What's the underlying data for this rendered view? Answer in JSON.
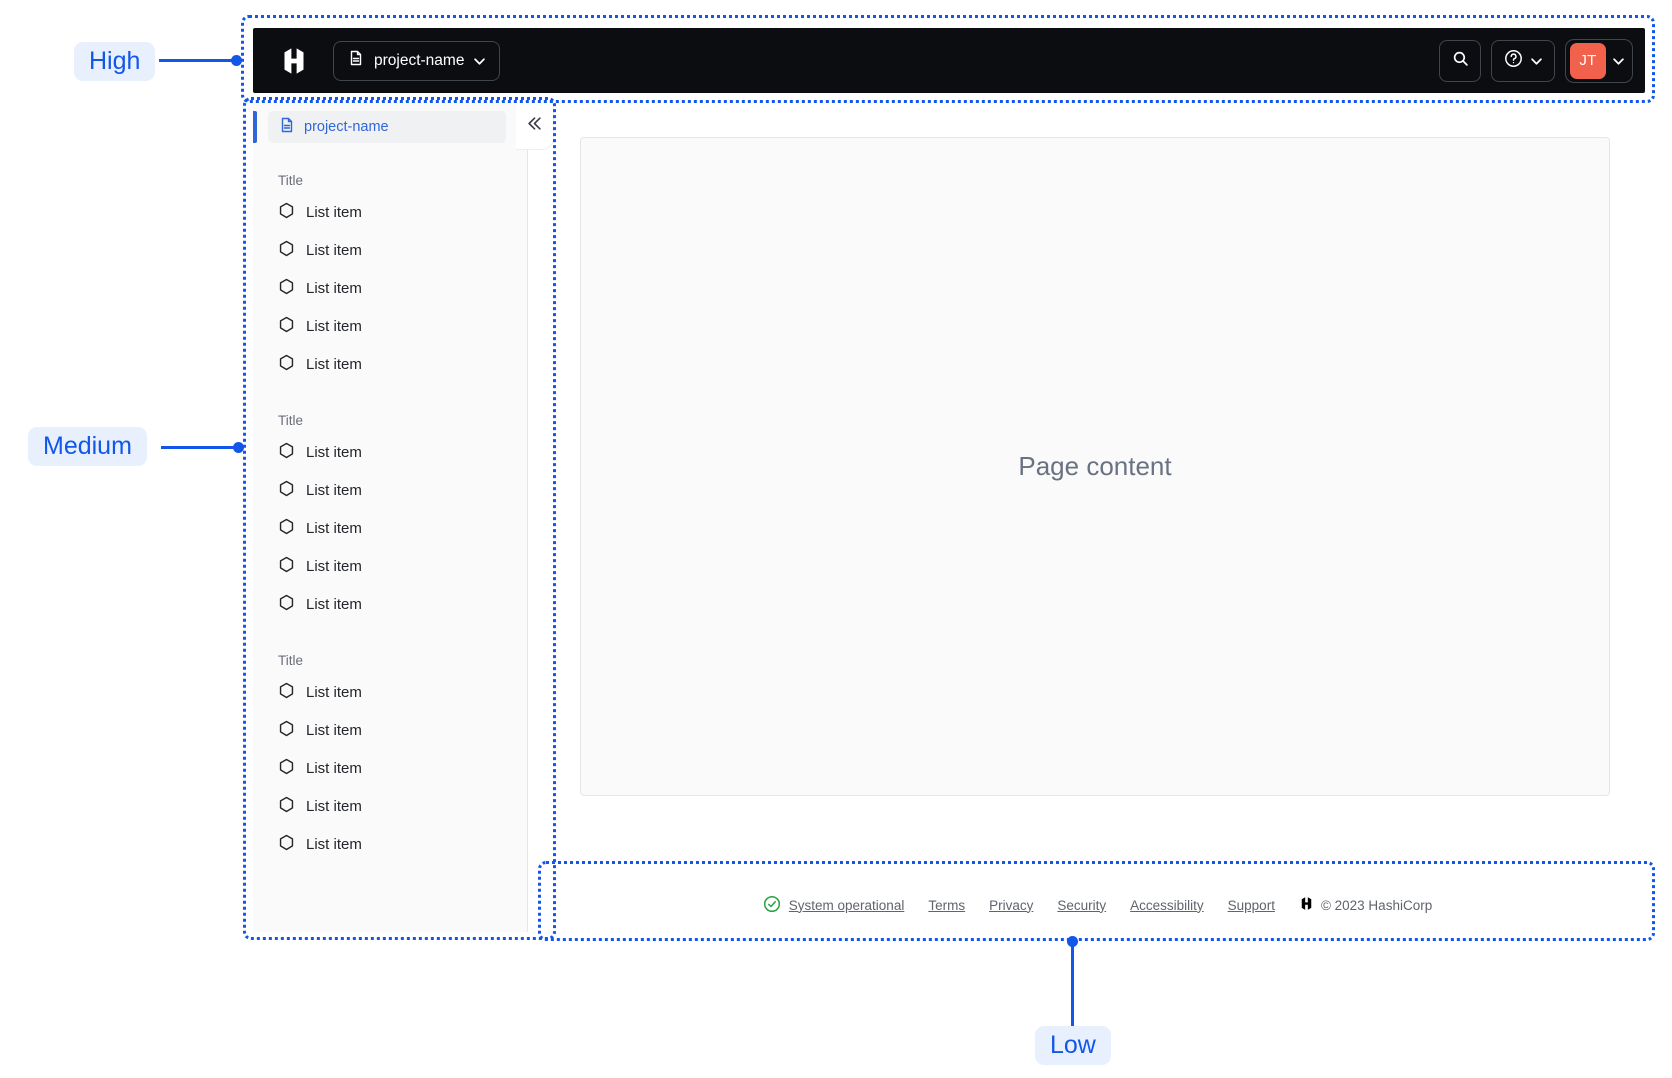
{
  "annotations": {
    "color": "#1257E9",
    "high": "High",
    "medium": "Medium",
    "low": "Low"
  },
  "navbar": {
    "background_color": "#0C0D10",
    "logo": "hashicorp-logo",
    "project_switcher": "project-name",
    "user_initials": "JT",
    "avatar_color": "#F2614C"
  },
  "sidebar": {
    "active_item": "project-name",
    "sections": [
      {
        "title": "Title",
        "items": [
          "List item",
          "List item",
          "List item",
          "List item",
          "List item"
        ]
      },
      {
        "title": "Title",
        "items": [
          "List item",
          "List item",
          "List item",
          "List item",
          "List item"
        ]
      },
      {
        "title": "Title",
        "items": [
          "List item",
          "List item",
          "List item",
          "List item",
          "List item"
        ]
      }
    ]
  },
  "content": {
    "placeholder": "Page content"
  },
  "footer": {
    "status_label": "System operational",
    "status_color": "#27A33F",
    "links": [
      "Terms",
      "Privacy",
      "Security",
      "Accessibility",
      "Support"
    ],
    "copyright": "© 2023 HashiCorp"
  }
}
